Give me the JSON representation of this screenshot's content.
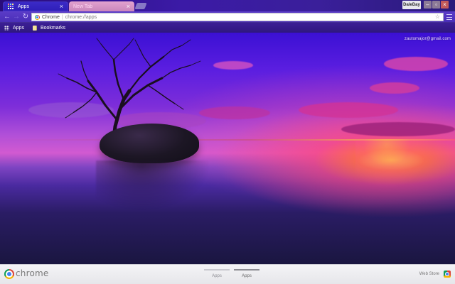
{
  "tabs": [
    {
      "title": "Apps",
      "active": true
    },
    {
      "title": "New Tab",
      "active": false
    }
  ],
  "window": {
    "profile": "DaleDay"
  },
  "toolbar": {
    "omnibox_brand": "Chrome",
    "omnibox_separator": "|",
    "omnibox_url": "chrome://apps"
  },
  "bookmarks_bar": {
    "items": [
      {
        "label": "Apps",
        "icon": "apps-grid-icon"
      },
      {
        "label": "Bookmarks",
        "icon": "bookmark-folder-icon"
      }
    ]
  },
  "content": {
    "user_email": "zautomajor@gmail.com"
  },
  "bottom_bar": {
    "wordmark": "chrome",
    "pages": [
      {
        "label": "Apps",
        "active": false
      },
      {
        "label": "Apps",
        "active": true
      }
    ],
    "webstore_label": "Web Store"
  },
  "colors": {
    "toolbar": "#4a2fb8",
    "tabstrip": "#2a0d7c",
    "bottom_bar": "#eeeeee",
    "close_button": "#c45a5a"
  }
}
